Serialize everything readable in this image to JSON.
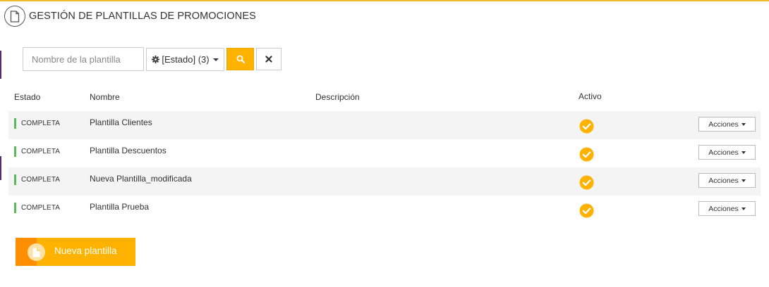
{
  "header": {
    "title": "GESTIÓN DE PLANTILLAS DE PROMOCIONES",
    "icon": "document-icon"
  },
  "filters": {
    "search_placeholder": "Nombre de la plantilla",
    "search_value": "",
    "estado_label": "[Estado] (3)",
    "estado_icon": "gear-icon",
    "search_button_icon": "search-icon",
    "clear_button_icon": "close-icon"
  },
  "table": {
    "columns": {
      "estado": "Estado",
      "nombre": "Nombre",
      "descripcion": "Descripción",
      "activo": "Activo"
    },
    "rows": [
      {
        "estado": "COMPLETA",
        "nombre": "Plantilla Clientes",
        "descripcion": "",
        "activo": true,
        "acciones": "Acciones"
      },
      {
        "estado": "COMPLETA",
        "nombre": "Plantilla Descuentos",
        "descripcion": "",
        "activo": true,
        "acciones": "Acciones"
      },
      {
        "estado": "COMPLETA",
        "nombre": "Nueva Plantilla_modificada",
        "descripcion": "",
        "activo": true,
        "acciones": "Acciones"
      },
      {
        "estado": "COMPLETA",
        "nombre": "Plantilla Prueba",
        "descripcion": "",
        "activo": true,
        "acciones": "Acciones"
      }
    ]
  },
  "new_button": {
    "label": "Nueva plantilla",
    "icon": "document-icon"
  },
  "colors": {
    "accent": "#ffb300",
    "accent_dark": "#ff8f00",
    "status_complete": "#5cb85c",
    "top_line": "#f0b82a",
    "side_accent": "#5b2a6e"
  }
}
